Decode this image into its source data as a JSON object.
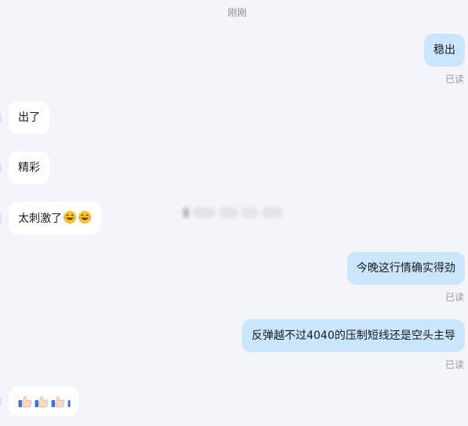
{
  "timestamp": "刚刚",
  "messages": [
    {
      "text": "稳出",
      "read": "已读"
    },
    {
      "text": "出了"
    },
    {
      "text": "精彩"
    },
    {
      "text": "太刺激了"
    },
    {
      "text": "今晚这行情确实得劲",
      "read": "已读"
    },
    {
      "text": "反弹越不过4040的压制短线还是空头主导",
      "read": "已读"
    }
  ],
  "colors": {
    "background": "#f4f5fa",
    "incoming_bubble": "#ffffff",
    "outgoing_bubble": "#c9e6fd"
  },
  "icons": {
    "laugh": "face-with-tears-of-joy-icon",
    "thumb": "thumbs-up-icon"
  }
}
